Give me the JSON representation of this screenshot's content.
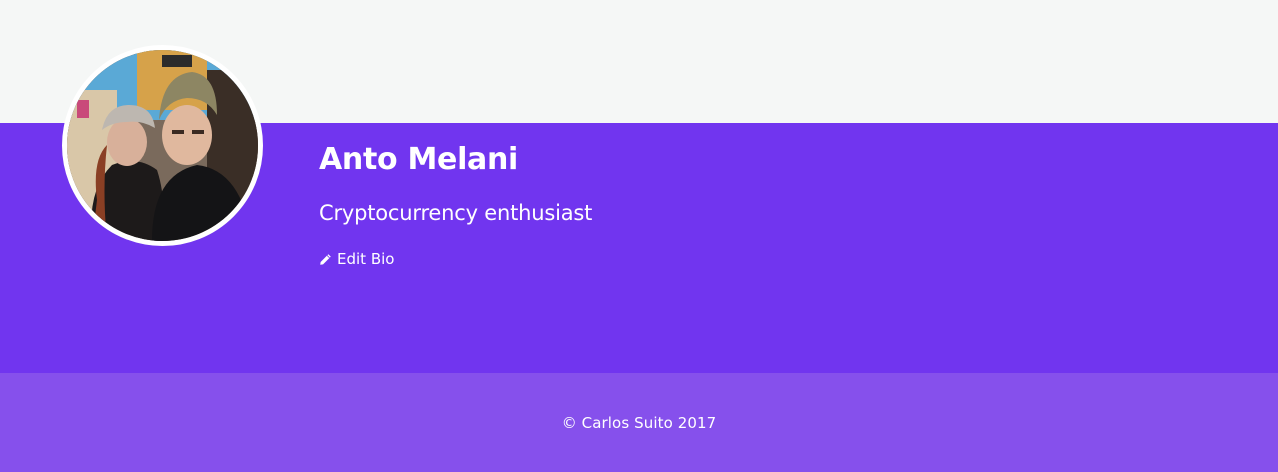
{
  "profile": {
    "name": "Anto Melani",
    "bio": "Cryptocurrency enthusiast",
    "edit_bio_label": "Edit Bio",
    "edit_icon": "pencil-icon",
    "avatar_alt": "profile-photo"
  },
  "footer": {
    "copyright": "© Carlos Suito 2017"
  },
  "colors": {
    "page_background": "#f5f7f6",
    "profile_band": "#7135ef",
    "footer_band": "#8650ec",
    "text": "#ffffff"
  }
}
